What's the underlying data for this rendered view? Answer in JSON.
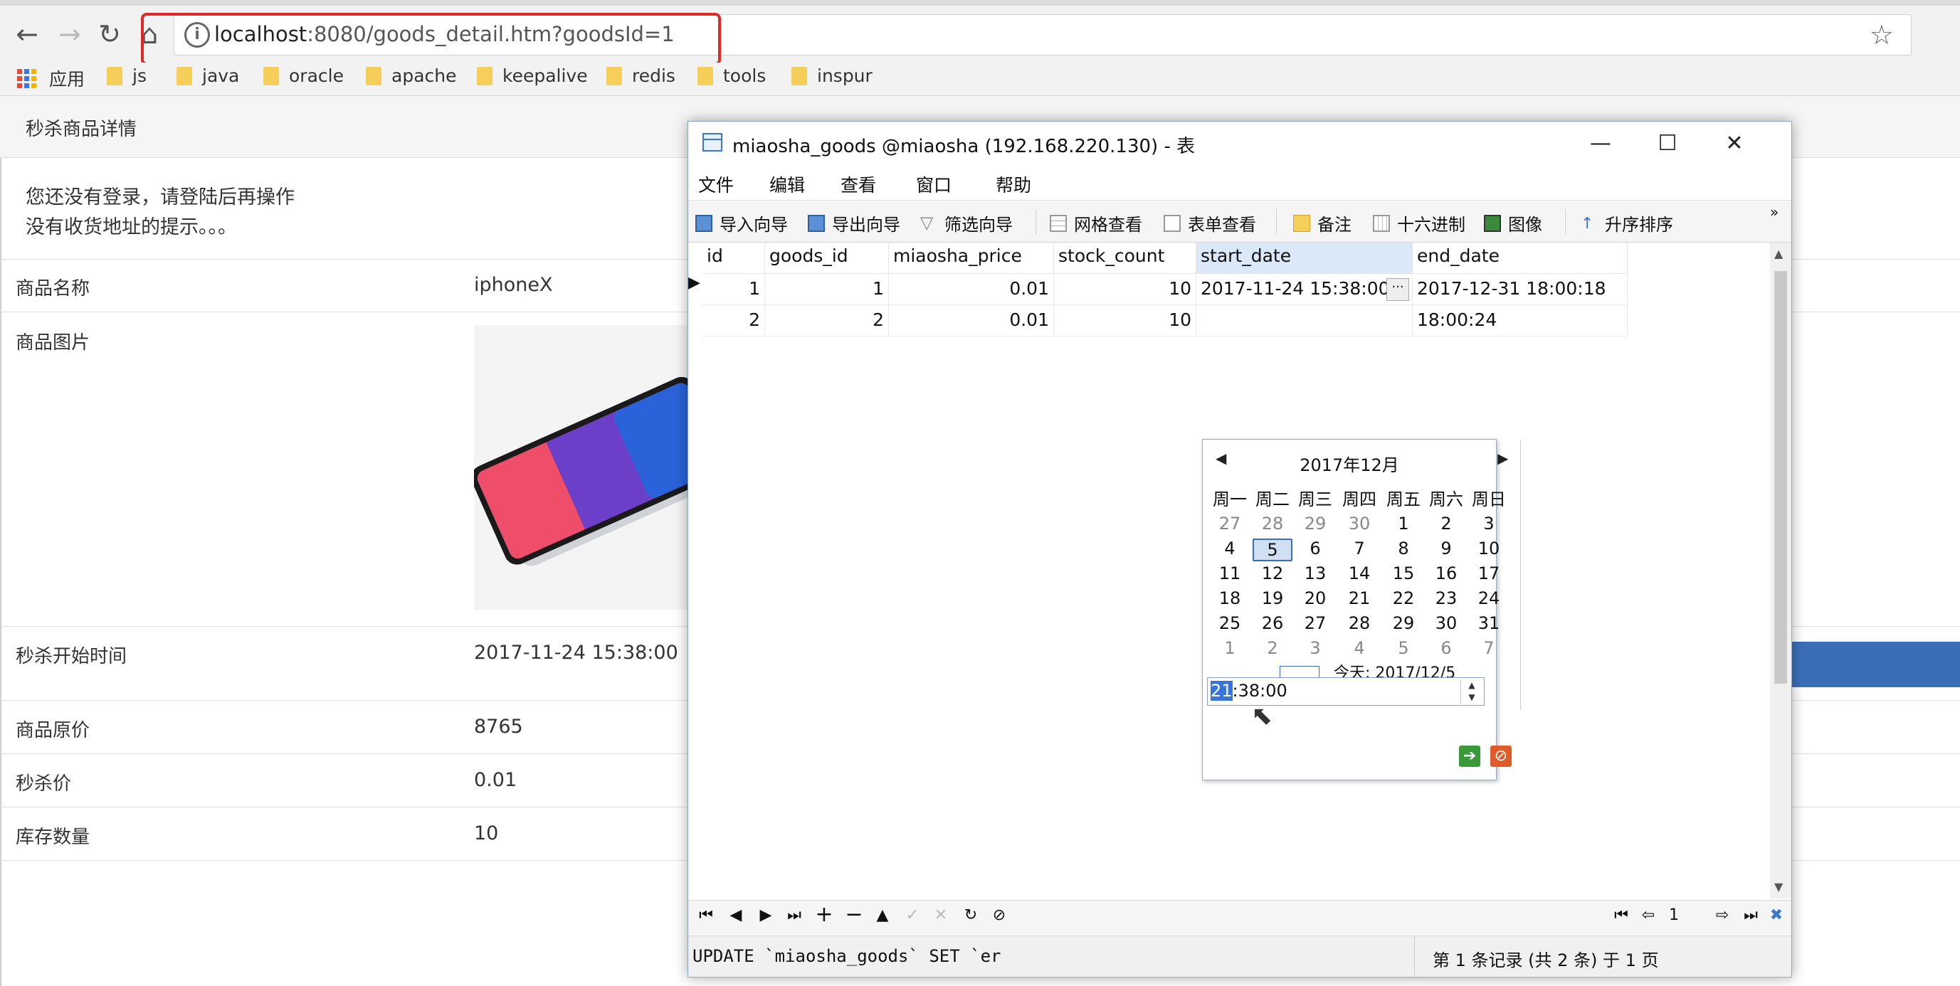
{
  "browser": {
    "url_host": "localhost",
    "url_path": ":8080/goods_detail.htm?goodsId=1",
    "bookmarks": [
      "应用",
      "js",
      "java",
      "oracle",
      "apache",
      "keepalive",
      "redis",
      "tools",
      "inspur"
    ]
  },
  "page": {
    "panel_title": "秒杀商品详情",
    "notice_line1": "您还没有登录，请登陆后再操作",
    "notice_line2": "没有收货地址的提示。。。",
    "rows": [
      {
        "label": "商品名称",
        "value": "iphoneX"
      },
      {
        "label": "商品图片",
        "value": ""
      },
      {
        "label": "秒杀开始时间",
        "value": "2017-11-24 15:38:00"
      },
      {
        "label": "商品原价",
        "value": "8765"
      },
      {
        "label": "秒杀价",
        "value": "0.01"
      },
      {
        "label": "库存数量",
        "value": "10"
      }
    ],
    "accent_color": "#3a6fb8"
  },
  "navicat": {
    "title": "miaosha_goods @miaosha (192.168.220.130) - 表",
    "menu": [
      "文件",
      "编辑",
      "查看",
      "窗口",
      "帮助"
    ],
    "toolbar": [
      "导入向导",
      "导出向导",
      "筛选向导",
      "网格查看",
      "表单查看",
      "备注",
      "十六进制",
      "图像",
      "升序排序"
    ],
    "columns": [
      "id",
      "goods_id",
      "miaosha_price",
      "stock_count",
      "start_date",
      "end_date"
    ],
    "rows": [
      [
        "1",
        "1",
        "0.01",
        "10",
        "2017-11-24 15:38:00",
        "2017-12-31 18:00:18"
      ],
      [
        "2",
        "2",
        "0.01",
        "10",
        "",
        "18:00:24"
      ]
    ],
    "datepicker": {
      "month_label": "2017年12月",
      "weekdays": [
        "周一",
        "周二",
        "周三",
        "周四",
        "周五",
        "周六",
        "周日"
      ],
      "weeks": [
        [
          "27",
          "28",
          "29",
          "30",
          "1",
          "2",
          "3"
        ],
        [
          "4",
          "5",
          "6",
          "7",
          "8",
          "9",
          "10"
        ],
        [
          "11",
          "12",
          "13",
          "14",
          "15",
          "16",
          "17"
        ],
        [
          "18",
          "19",
          "20",
          "21",
          "22",
          "23",
          "24"
        ],
        [
          "25",
          "26",
          "27",
          "28",
          "29",
          "30",
          "31"
        ],
        [
          "1",
          "2",
          "3",
          "4",
          "5",
          "6",
          "7"
        ]
      ],
      "today_label": "今天: 2017/12/5",
      "selected_day": "5",
      "time_hour": "21",
      "time_rest": ":38:00"
    },
    "status_sql": "UPDATE `miaosha_goods` SET `er",
    "status_record": "第 1 条记录 (共 2 条) 于 1 页",
    "page_number": "1"
  }
}
